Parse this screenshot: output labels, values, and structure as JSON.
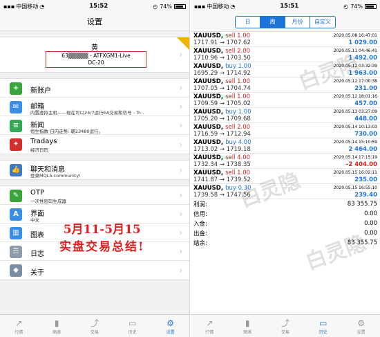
{
  "left": {
    "status": {
      "carrier": "中国移动",
      "wifi": "wifi-icon",
      "time": "15:52",
      "battery": "74%"
    },
    "title": "设置",
    "profile": {
      "name": "黄",
      "account": "63▒▒▒▒▒ - ATFXGM1-Live",
      "server": "DC-20",
      "badge": "Gold"
    },
    "items": [
      {
        "icon": "add-user-icon",
        "color": "#3aa53a",
        "title": "新账户",
        "sub": ""
      },
      {
        "icon": "mail-icon",
        "color": "#3b8ee6",
        "title": "邮箱",
        "sub": "内置虚拟主机——现在可以24/7运行EA交易和信号 - Tr..."
      },
      {
        "icon": "news-icon",
        "color": "#34a853",
        "title": "新闻",
        "sub": "恒生指数 日内走势: 朝23480运行。"
      },
      {
        "icon": "tradays-icon",
        "color": "#d0312d",
        "title": "Tradays",
        "sub": "经济日历"
      }
    ],
    "chat": {
      "icon": "thumbs-up-icon",
      "color": "#3d78c9",
      "title": "聊天和消息",
      "sub": "登录MQL5.community!"
    },
    "items2": [
      {
        "icon": "key-icon",
        "color": "#3aa53a",
        "title": "OTP",
        "sub": "一次性密码生成器"
      },
      {
        "icon": "language-icon",
        "color": "#3b8ee6",
        "title": "界面",
        "sub": "中文"
      },
      {
        "icon": "chart-icon",
        "color": "#3b8ee6",
        "title": "图表",
        "sub": ""
      },
      {
        "icon": "journal-icon",
        "color": "#8e9bab",
        "title": "日志",
        "sub": ""
      },
      {
        "icon": "about-icon",
        "color": "#7a8fa6",
        "title": "关于",
        "sub": ""
      }
    ],
    "overlay": {
      "line1": "5月11-5月15",
      "line2": "实盘交易总结!"
    },
    "tabs": [
      {
        "label": "行情",
        "icon": "quotes-icon"
      },
      {
        "label": "图表",
        "icon": "candles-icon"
      },
      {
        "label": "交易",
        "icon": "trade-icon"
      },
      {
        "label": "历史",
        "icon": "history-icon"
      },
      {
        "label": "设置",
        "icon": "gear-icon",
        "active": true
      }
    ]
  },
  "right": {
    "status": {
      "carrier": "中国移动",
      "wifi": "wifi-icon",
      "time": "15:51",
      "battery": "74%"
    },
    "segments": [
      {
        "label": "日"
      },
      {
        "label": "周",
        "active": true
      },
      {
        "label": "月份"
      },
      {
        "label": "自定义"
      }
    ],
    "deals": [
      {
        "sym": "XAUUSD,",
        "act": "sell 1.00",
        "type": "sell",
        "date": "2020.05.08 16:47:01",
        "prices": "1717.91 → 1707.62",
        "profit": "1 029.00",
        "pos": true
      },
      {
        "sym": "XAUUSD,",
        "act": "sell 2.00",
        "type": "sell",
        "date": "2020.05.11 04:46:41",
        "prices": "1710.96 → 1703.50",
        "profit": "1 492.00",
        "pos": true
      },
      {
        "sym": "XAUUSD,",
        "act": "buy 1.00",
        "type": "buy",
        "date": "2020.05.12 03:32:39",
        "prices": "1695.29 → 1714.92",
        "profit": "1 963.00",
        "pos": true
      },
      {
        "sym": "XAUUSD,",
        "act": "sell 1.00",
        "type": "sell",
        "date": "2020.05.12 17:00:38",
        "prices": "1707.05 → 1704.74",
        "profit": "231.00",
        "pos": true
      },
      {
        "sym": "XAUUSD,",
        "act": "sell 1.00",
        "type": "sell",
        "date": "2020.05.12 18:01:16",
        "prices": "1709.59 → 1705.02",
        "profit": "457.00",
        "pos": true
      },
      {
        "sym": "XAUUSD,",
        "act": "buy 1.00",
        "type": "buy",
        "date": "2020.05.13 03:27:09",
        "prices": "1705.20 → 1709.68",
        "profit": "448.00",
        "pos": true
      },
      {
        "sym": "XAUUSD,",
        "act": "sell 2.00",
        "type": "sell",
        "date": "2020.05.14 10:13:03",
        "prices": "1716.59 → 1712.94",
        "profit": "730.00",
        "pos": true
      },
      {
        "sym": "XAUUSD,",
        "act": "buy 4.00",
        "type": "buy",
        "date": "2020.05.14 15:10:59",
        "prices": "1713.02 → 1719.18",
        "profit": "2 464.00",
        "pos": true
      },
      {
        "sym": "XAUUSD,",
        "act": "sell 4.00",
        "type": "sell",
        "date": "2020.05.14 17:15:19",
        "prices": "1732.34 → 1738.35",
        "profit": "-2 404.00",
        "pos": false
      },
      {
        "sym": "XAUUSD,",
        "act": "sell 1.00",
        "type": "sell",
        "date": "2020.05.15 16:02:11",
        "prices": "1741.87 → 1739.52",
        "profit": "235.00",
        "pos": true
      },
      {
        "sym": "XAUUSD,",
        "act": "buy 0.30",
        "type": "buy",
        "date": "2020.05.15 16:55:10",
        "prices": "1739.58 → 1747.56",
        "profit": "239.40",
        "pos": true
      }
    ],
    "summary": [
      {
        "label": "利润:",
        "value": "83 355.75"
      },
      {
        "label": "信用:",
        "value": "0.00"
      },
      {
        "label": "入金:",
        "value": "0.00"
      },
      {
        "label": "出金:",
        "value": "0.00"
      },
      {
        "label": "结余:",
        "value": "83 355.75"
      }
    ],
    "tabs": [
      {
        "label": "行情",
        "icon": "quotes-icon"
      },
      {
        "label": "图表",
        "icon": "candles-icon"
      },
      {
        "label": "交易",
        "icon": "trade-icon"
      },
      {
        "label": "历史",
        "icon": "history-icon",
        "active": true
      },
      {
        "label": "设置",
        "icon": "gear-icon"
      }
    ]
  },
  "watermark": "白灵隐"
}
